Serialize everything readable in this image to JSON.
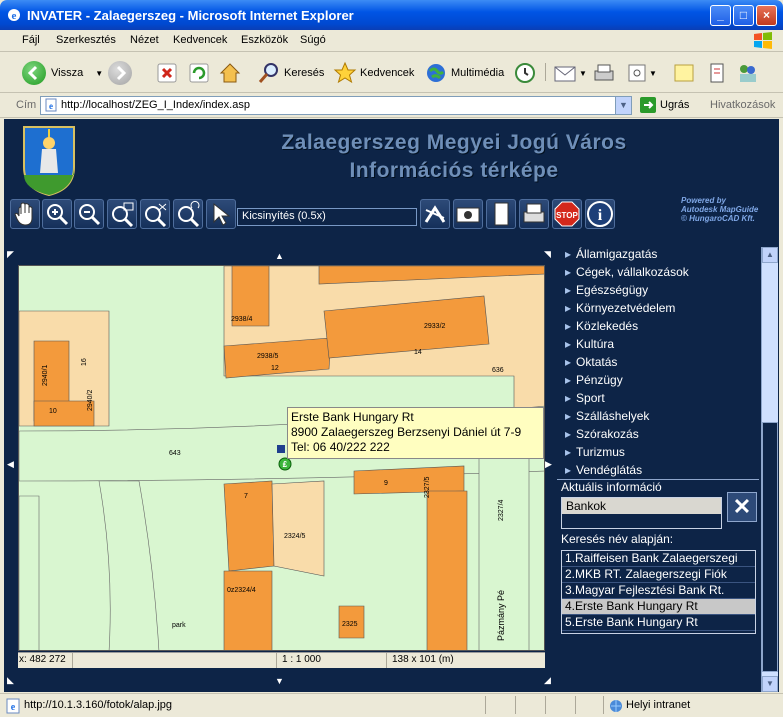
{
  "window": {
    "title": "INVATER - Zalaegerszeg - Microsoft Internet Explorer",
    "controls": [
      "_",
      "□",
      "×"
    ]
  },
  "menu": [
    "Fájl",
    "Szerkesztés",
    "Nézet",
    "Kedvencek",
    "Eszközök",
    "Súgó"
  ],
  "toolbar": {
    "back": "Vissza",
    "search": "Keresés",
    "favorites": "Kedvencek",
    "media": "Multimédia"
  },
  "address": {
    "label": "Cím",
    "url": "http://localhost/ZEG_I_Index/index.asp",
    "go": "Ugrás",
    "links": "Hivatkozások"
  },
  "site": {
    "title_line1": "Zalaegerszeg Megyei Jogú Város",
    "title_line2": "Információs térképe",
    "powered1": "Powered by",
    "powered2": "Autodesk MapGuide",
    "powered3": "© HungaroCAD Kft."
  },
  "map_tools": {
    "scale_select": "Kicsinyítés (0.5x)",
    "stop_label": "STOP",
    "info_label": "i"
  },
  "map": {
    "tooltip_line1": "Erste Bank Hungary Rt",
    "tooltip_line2": "8900 Zalaegerszeg Berzsenyi Dániel út 7-9",
    "tooltip_line3": "Tel: 06 40/222 222",
    "labels": {
      "l2938_4": "2938/4",
      "l2938_5": "2938/5",
      "l12": "12",
      "l2933_2": "2933/2",
      "l14": "14",
      "l636": "636",
      "l2940_1": "2940/1",
      "l10": "10",
      "l2940_2": "2940/2",
      "l643": "643",
      "l7": "7",
      "l2324_5": "2324/5",
      "l9": "9",
      "l2327_5": "2327/5",
      "l2327_4": "2327/4",
      "l2324_4": "0z2324/4",
      "l2325": "2325",
      "lpark": "park",
      "lpazmany": "Pázmány Pé",
      "l1": "1",
      "l16": "16"
    },
    "status_x": "x: 482 272",
    "status_scale": "1 : 1 000",
    "status_size": "138 x 101 (m)"
  },
  "panel": {
    "categories": [
      "Államigazgatás",
      "Cégek, vállalkozások",
      "Egészségügy",
      "Környezetvédelem",
      "Közlekedés",
      "Kultúra",
      "Oktatás",
      "Pénzügy",
      "Sport",
      "Szálláshelyek",
      "Szórakozás",
      "Turizmus",
      "Vendéglátás"
    ],
    "aktualis_label": "Aktuális információ",
    "aktualis_value": "Bankok",
    "close_label": "✕",
    "search_label": "Keresés név alapján:",
    "results": [
      "1.Raiffeisen Bank Zalaegerszegi",
      "2.MKB RT. Zalaegerszegi Fiók",
      "3.Magyar Fejlesztési Bank Rt.",
      "4.Erste Bank Hungary Rt",
      "5.Erste Bank Hungary Rt"
    ],
    "selected_index": 3
  },
  "status": {
    "url": "http://10.1.3.160/fotok/alap.jpg",
    "zone": "Helyi intranet"
  }
}
